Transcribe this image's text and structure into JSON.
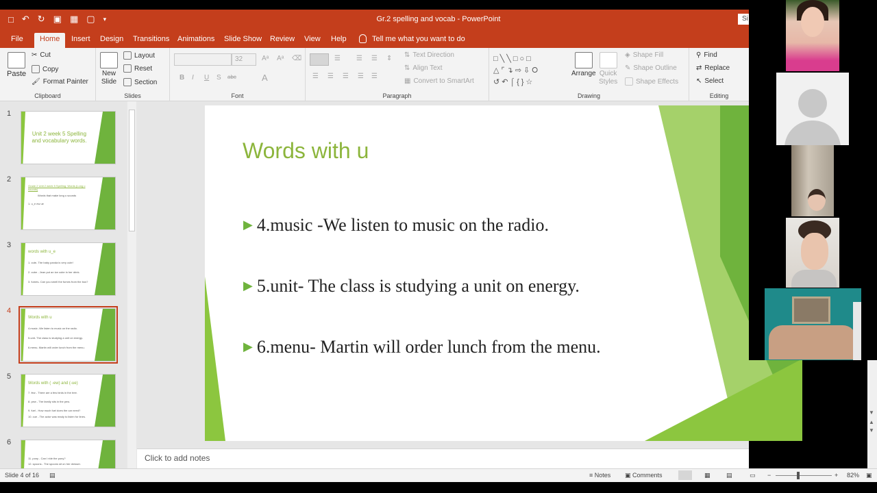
{
  "window": {
    "title": "Gr.2 spelling and vocab  -  PowerPoint",
    "signin_label": "Si"
  },
  "quick_access": {
    "save_icon": "save-icon",
    "undo_icon": "undo-icon",
    "redo_icon": "redo-icon"
  },
  "tabs": [
    "File",
    "Home",
    "Insert",
    "Design",
    "Transitions",
    "Animations",
    "Slide Show",
    "Review",
    "View",
    "Help"
  ],
  "tell_me": "Tell me what you want to do",
  "ribbon": {
    "clipboard": {
      "paste": "Paste",
      "cut": "Cut",
      "copy": "Copy",
      "format_painter": "Format Painter",
      "label": "Clipboard"
    },
    "slides": {
      "new_slide_1": "New",
      "new_slide_2": "Slide",
      "layout": "Layout",
      "reset": "Reset",
      "section": "Section",
      "label": "Slides"
    },
    "font": {
      "font_size": "32",
      "label": "Font",
      "bold": "B",
      "italic": "I",
      "underline": "U",
      "shadow": "S",
      "strike": "abc",
      "font_color": "A"
    },
    "paragraph": {
      "text_direction": "Text Direction",
      "align_text": "Align Text",
      "convert_smartart": "Convert to SmartArt",
      "label": "Paragraph"
    },
    "drawing": {
      "arrange": "Arrange",
      "quick_styles_1": "Quick",
      "quick_styles_2": "Styles",
      "shape_fill": "Shape Fill",
      "shape_outline": "Shape Outline",
      "shape_effects": "Shape Effects",
      "label": "Drawing"
    },
    "editing": {
      "find": "Find",
      "replace": "Replace",
      "select": "Select",
      "label": "Editing"
    }
  },
  "thumbnails": [
    {
      "num": "1",
      "title": "Unit 2 week 5 Spelling and vocabulary words."
    },
    {
      "num": "2",
      "title": "Grade 2 Unit 2 week 5 Spelling: Words (Long u sounds)",
      "lines": [
        "Words that make long u sounds",
        "1. u_e     ew     ue"
      ]
    },
    {
      "num": "3",
      "title": "words with u_e",
      "lines": [
        "1. cute- The baby panda is very cute!",
        "2. cube - Jean put an ice cube in her drink.",
        "3. fumes- Can you smell the fumes from the bus?"
      ]
    },
    {
      "num": "4",
      "title": "Words with u",
      "lines": [
        "4.music -We listen to music on the radio.",
        "5.unit- The class is studying a unit on energy.",
        "6.menu- Martin will order lunch from the menu."
      ]
    },
    {
      "num": "5",
      "title": "Words with ( -ew) and (-ue)",
      "lines": [
        "7. few - There are a few birds in the tree.",
        "8. pew - The family sits in the pew.",
        "9. fuel - How much fuel does the car need?",
        "10. cue - The actor was ready to listen for lines."
      ]
    },
    {
      "num": "6",
      "lines": [
        "11. pony - Can I ride the pony?",
        "12. spoons - The spoons sit on her dresser."
      ]
    }
  ],
  "slide": {
    "title": "Words with u",
    "bullets": [
      "4.music -We listen to music on the radio.",
      "5.unit- The class is studying a unit on energy.",
      "6.menu- Martin will order lunch from the menu."
    ]
  },
  "notes_placeholder": "Click to add notes",
  "status": {
    "slide_of": "Slide 4 of 16",
    "notes": "Notes",
    "comments": "Comments",
    "zoom": "82%"
  },
  "colors": {
    "accent": "#c43e1c",
    "green": "#8cb53c"
  }
}
